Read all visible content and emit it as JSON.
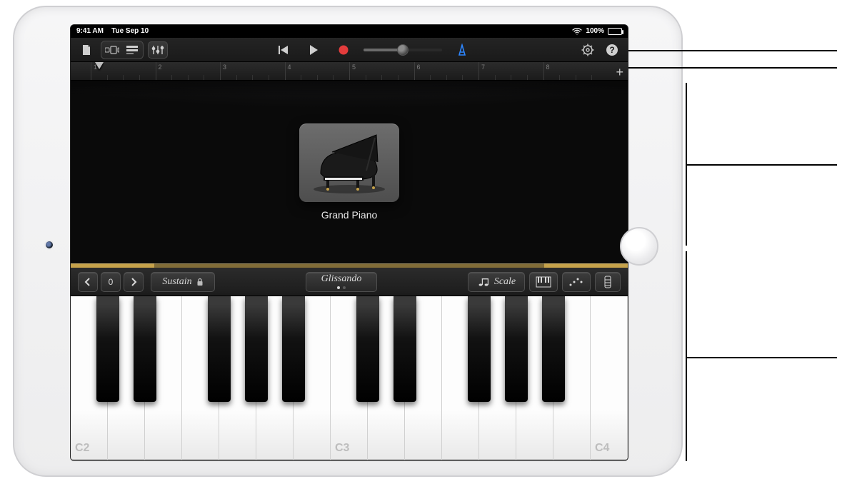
{
  "status": {
    "time": "9:41 AM",
    "date": "Tue Sep 10",
    "battery": "100%"
  },
  "toolbar": {
    "my_songs": "my-songs",
    "browser": "sound-browser",
    "tracks": "tracks-view",
    "controls": "track-controls",
    "rewind": "rewind",
    "play": "play",
    "record": "record",
    "metronome": "metronome",
    "settings": "settings",
    "help": "help"
  },
  "ruler": {
    "bars": [
      "1",
      "2",
      "3",
      "4",
      "5",
      "6",
      "7",
      "8"
    ],
    "add": "+"
  },
  "sound": {
    "name": "Grand Piano"
  },
  "controls": {
    "octave_down": "‹",
    "octave_value": "0",
    "octave_up": "›",
    "sustain": "Sustain",
    "glissando": "Glissando",
    "scale_icon": "♩♩",
    "scale_label": "Scale"
  },
  "keys": {
    "labels": {
      "c2": "C2",
      "c3": "C3",
      "c4": "C4"
    }
  }
}
